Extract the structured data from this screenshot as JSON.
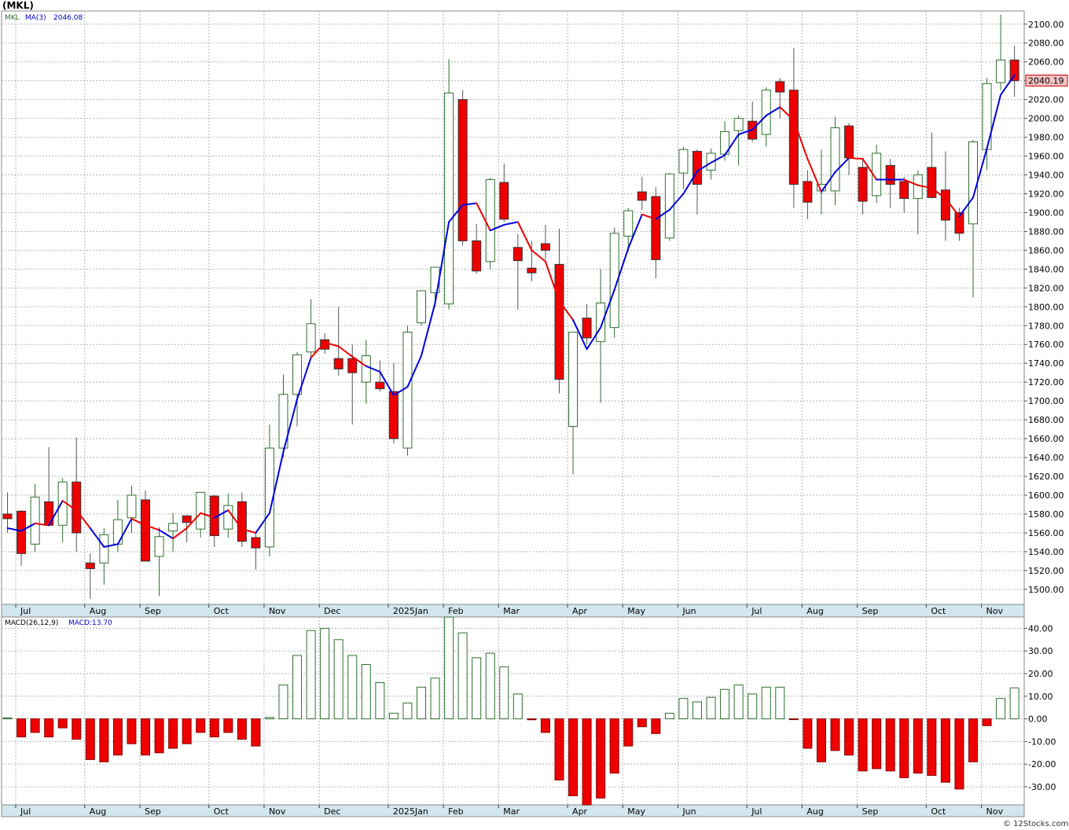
{
  "header": {
    "symbol": "(MKL)"
  },
  "chart_data": {
    "type": "candlestick",
    "symbol_label": "MKL",
    "ma_label": "MA(3)",
    "ma_value": "2046.08",
    "last_price": "2040.19",
    "price_axis": {
      "range": [
        1484,
        2114
      ],
      "ticks": [
        1500,
        1520,
        1540,
        1560,
        1580,
        1600,
        1620,
        1640,
        1660,
        1680,
        1700,
        1720,
        1740,
        1760,
        1780,
        1800,
        1820,
        1840,
        1860,
        1880,
        1900,
        1920,
        1940,
        1960,
        1980,
        2000,
        2020,
        2040,
        2060,
        2080,
        2100
      ],
      "tick_labels": [
        "1500.00",
        "1520.00",
        "1540.00",
        "1560.00",
        "1580.00",
        "1600.00",
        "1620.00",
        "1640.00",
        "1660.00",
        "1680.00",
        "1700.00",
        "1720.00",
        "1740.00",
        "1760.00",
        "1780.00",
        "1800.00",
        "1820.00",
        "1840.00",
        "1860.00",
        "1880.00",
        "1900.00",
        "1920.00",
        "1940.00",
        "1960.00",
        "1980.00",
        "2000.00",
        "2020.00",
        "2040.00",
        "2060.00",
        "2080.00",
        "2100.00"
      ]
    },
    "months": [
      {
        "label": "Jul",
        "index": 1
      },
      {
        "label": "Aug",
        "index": 6
      },
      {
        "label": "Sep",
        "index": 10
      },
      {
        "label": "Oct",
        "index": 15
      },
      {
        "label": "Nov",
        "index": 19
      },
      {
        "label": "Dec",
        "index": 23
      },
      {
        "label": "2025Jan",
        "index": 28
      },
      {
        "label": "Feb",
        "index": 32
      },
      {
        "label": "Mar",
        "index": 36
      },
      {
        "label": "Apr",
        "index": 41
      },
      {
        "label": "May",
        "index": 45
      },
      {
        "label": "Jun",
        "index": 49
      },
      {
        "label": "Jul",
        "index": 54
      },
      {
        "label": "Aug",
        "index": 58
      },
      {
        "label": "Sep",
        "index": 62
      },
      {
        "label": "Oct",
        "index": 67
      },
      {
        "label": "Nov",
        "index": 71
      }
    ],
    "candles": [
      {
        "o": 1580,
        "h": 1603,
        "l": 1560,
        "c": 1575
      },
      {
        "o": 1583,
        "h": 1584,
        "l": 1525,
        "c": 1538
      },
      {
        "o": 1548,
        "h": 1612,
        "l": 1540,
        "c": 1598
      },
      {
        "o": 1593,
        "h": 1651,
        "l": 1573,
        "c": 1568
      },
      {
        "o": 1568,
        "h": 1618,
        "l": 1550,
        "c": 1614
      },
      {
        "o": 1614,
        "h": 1661,
        "l": 1540,
        "c": 1560
      },
      {
        "o": 1528,
        "h": 1538,
        "l": 1490,
        "c": 1522
      },
      {
        "o": 1528,
        "h": 1565,
        "l": 1505,
        "c": 1558
      },
      {
        "o": 1548,
        "h": 1595,
        "l": 1540,
        "c": 1574
      },
      {
        "o": 1576,
        "h": 1610,
        "l": 1560,
        "c": 1600
      },
      {
        "o": 1595,
        "h": 1605,
        "l": 1530,
        "c": 1530
      },
      {
        "o": 1535,
        "h": 1566,
        "l": 1493,
        "c": 1556
      },
      {
        "o": 1562,
        "h": 1581,
        "l": 1540,
        "c": 1570
      },
      {
        "o": 1578,
        "h": 1579,
        "l": 1550,
        "c": 1571
      },
      {
        "o": 1564,
        "h": 1603,
        "l": 1555,
        "c": 1603
      },
      {
        "o": 1599,
        "h": 1600,
        "l": 1545,
        "c": 1557
      },
      {
        "o": 1564,
        "h": 1602,
        "l": 1555,
        "c": 1589
      },
      {
        "o": 1593,
        "h": 1603,
        "l": 1545,
        "c": 1551
      },
      {
        "o": 1555,
        "h": 1560,
        "l": 1521,
        "c": 1544
      },
      {
        "o": 1545,
        "h": 1675,
        "l": 1535,
        "c": 1650
      },
      {
        "o": 1650,
        "h": 1728,
        "l": 1640,
        "c": 1707
      },
      {
        "o": 1707,
        "h": 1752,
        "l": 1673,
        "c": 1749
      },
      {
        "o": 1752,
        "h": 1808,
        "l": 1745,
        "c": 1782
      },
      {
        "o": 1765,
        "h": 1772,
        "l": 1750,
        "c": 1755
      },
      {
        "o": 1745,
        "h": 1800,
        "l": 1727,
        "c": 1734
      },
      {
        "o": 1745,
        "h": 1760,
        "l": 1675,
        "c": 1730
      },
      {
        "o": 1720,
        "h": 1765,
        "l": 1697,
        "c": 1748
      },
      {
        "o": 1720,
        "h": 1743,
        "l": 1710,
        "c": 1713
      },
      {
        "o": 1710,
        "h": 1740,
        "l": 1655,
        "c": 1660
      },
      {
        "o": 1650,
        "h": 1780,
        "l": 1642,
        "c": 1773
      },
      {
        "o": 1783,
        "h": 1815,
        "l": 1780,
        "c": 1817
      },
      {
        "o": 1815,
        "h": 1842,
        "l": 1800,
        "c": 1842
      },
      {
        "o": 1803,
        "h": 2063,
        "l": 1797,
        "c": 2027
      },
      {
        "o": 2020,
        "h": 2030,
        "l": 1865,
        "c": 1870
      },
      {
        "o": 1870,
        "h": 1888,
        "l": 1835,
        "c": 1838
      },
      {
        "o": 1848,
        "h": 1937,
        "l": 1840,
        "c": 1935
      },
      {
        "o": 1932,
        "h": 1952,
        "l": 1890,
        "c": 1893
      },
      {
        "o": 1863,
        "h": 1877,
        "l": 1797,
        "c": 1849
      },
      {
        "o": 1841,
        "h": 1870,
        "l": 1827,
        "c": 1836
      },
      {
        "o": 1867,
        "h": 1887,
        "l": 1850,
        "c": 1860
      },
      {
        "o": 1845,
        "h": 1883,
        "l": 1708,
        "c": 1723
      },
      {
        "o": 1673,
        "h": 1773,
        "l": 1622,
        "c": 1773
      },
      {
        "o": 1788,
        "h": 1803,
        "l": 1760,
        "c": 1767
      },
      {
        "o": 1763,
        "h": 1840,
        "l": 1698,
        "c": 1804
      },
      {
        "o": 1778,
        "h": 1884,
        "l": 1767,
        "c": 1878
      },
      {
        "o": 1875,
        "h": 1905,
        "l": 1858,
        "c": 1902
      },
      {
        "o": 1922,
        "h": 1938,
        "l": 1903,
        "c": 1913
      },
      {
        "o": 1917,
        "h": 1927,
        "l": 1830,
        "c": 1850
      },
      {
        "o": 1873,
        "h": 1942,
        "l": 1870,
        "c": 1941
      },
      {
        "o": 1942,
        "h": 1970,
        "l": 1925,
        "c": 1967
      },
      {
        "o": 1965,
        "h": 1967,
        "l": 1898,
        "c": 1930
      },
      {
        "o": 1945,
        "h": 1968,
        "l": 1935,
        "c": 1963
      },
      {
        "o": 1962,
        "h": 1997,
        "l": 1955,
        "c": 1986
      },
      {
        "o": 1987,
        "h": 2003,
        "l": 1950,
        "c": 2000
      },
      {
        "o": 1997,
        "h": 2018,
        "l": 1975,
        "c": 1978
      },
      {
        "o": 1983,
        "h": 2033,
        "l": 1970,
        "c": 2030
      },
      {
        "o": 2039,
        "h": 2043,
        "l": 2000,
        "c": 2028
      },
      {
        "o": 2030,
        "h": 2075,
        "l": 1905,
        "c": 1930
      },
      {
        "o": 1933,
        "h": 1945,
        "l": 1893,
        "c": 1911
      },
      {
        "o": 1923,
        "h": 1967,
        "l": 1898,
        "c": 1930
      },
      {
        "o": 1923,
        "h": 2002,
        "l": 1908,
        "c": 1990
      },
      {
        "o": 1992,
        "h": 1995,
        "l": 1940,
        "c": 1958
      },
      {
        "o": 1948,
        "h": 1958,
        "l": 1898,
        "c": 1912
      },
      {
        "o": 1918,
        "h": 1972,
        "l": 1910,
        "c": 1963
      },
      {
        "o": 1950,
        "h": 1957,
        "l": 1905,
        "c": 1930
      },
      {
        "o": 1933,
        "h": 1938,
        "l": 1900,
        "c": 1915
      },
      {
        "o": 1915,
        "h": 1945,
        "l": 1877,
        "c": 1940
      },
      {
        "o": 1948,
        "h": 1985,
        "l": 1915,
        "c": 1916
      },
      {
        "o": 1924,
        "h": 1965,
        "l": 1870,
        "c": 1892
      },
      {
        "o": 1900,
        "h": 1905,
        "l": 1870,
        "c": 1878
      },
      {
        "o": 1888,
        "h": 1977,
        "l": 1810,
        "c": 1975
      },
      {
        "o": 1967,
        "h": 2043,
        "l": 1945,
        "c": 2037
      },
      {
        "o": 2038,
        "h": 2110,
        "l": 2030,
        "c": 2062
      },
      {
        "o": 2062,
        "h": 2077,
        "l": 2023,
        "c": 2040
      }
    ],
    "ma": [
      1565,
      1562,
      1570,
      1568,
      1594,
      1584,
      1565,
      1545,
      1548,
      1575,
      1568,
      1563,
      1554,
      1565,
      1581,
      1576,
      1584,
      1564,
      1560,
      1581,
      1646,
      1702,
      1746,
      1762,
      1758,
      1747,
      1737,
      1731,
      1706,
      1715,
      1748,
      1804,
      1890,
      1908,
      1910,
      1881,
      1887,
      1890,
      1860,
      1848,
      1806,
      1786,
      1755,
      1778,
      1818,
      1862,
      1898,
      1893,
      1903,
      1920,
      1944,
      1953,
      1961,
      1983,
      1988,
      2003,
      2012,
      1998,
      1957,
      1922,
      1943,
      1958,
      1957,
      1935,
      1935,
      1935,
      1929,
      1926,
      1915,
      1896,
      1916,
      1968,
      2025,
      2046
    ],
    "ma_colors": [
      "red",
      "blue",
      "blue",
      "red",
      "blue",
      "red",
      "red",
      "blue",
      "blue",
      "blue",
      "red",
      "red",
      "blue",
      "red",
      "red",
      "red",
      "blue",
      "red",
      "red",
      "blue",
      "blue",
      "blue",
      "blue",
      "red",
      "red",
      "red",
      "red",
      "blue",
      "blue",
      "blue",
      "blue",
      "blue",
      "blue",
      "blue",
      "blue",
      "red",
      "blue",
      "blue",
      "red",
      "red",
      "red",
      "red",
      "blue",
      "blue",
      "blue",
      "blue",
      "blue",
      "red",
      "blue",
      "blue",
      "blue",
      "blue",
      "blue",
      "blue",
      "blue",
      "blue",
      "blue",
      "red",
      "red",
      "red",
      "blue",
      "blue",
      "red",
      "red",
      "blue",
      "blue",
      "red",
      "red",
      "red",
      "red",
      "blue",
      "blue",
      "blue",
      "blue"
    ],
    "macd_label": "MACD(26,12,9)",
    "macd_value_label": "MACD:13.70",
    "macd_axis": {
      "range": [
        -38,
        45
      ],
      "ticks": [
        -30,
        -20,
        -10,
        0,
        10,
        20,
        30,
        40
      ],
      "tick_labels": [
        "-30.00",
        "-20.00",
        "-10.00",
        "0.00",
        "10.00",
        "20.00",
        "30.00",
        "40.00"
      ]
    },
    "macd": [
      0.4,
      -8,
      -6,
      -8,
      -4,
      -9,
      -18,
      -19,
      -16,
      -11,
      -16,
      -15,
      -13,
      -11,
      -6,
      -8,
      -6,
      -9,
      -12,
      0.6,
      15,
      28,
      39,
      40,
      35,
      28,
      24,
      16,
      2.5,
      7,
      14,
      18,
      45,
      38,
      27,
      29,
      23,
      11,
      -0.4,
      -6,
      -27,
      -34,
      -38,
      -35,
      -24,
      -12,
      -3.5,
      -6.5,
      2.5,
      9,
      7.5,
      9.5,
      13,
      15,
      11,
      14,
      14,
      -0.2,
      -13,
      -19,
      -14,
      -16,
      -23,
      -22,
      -23,
      -26,
      -24,
      -25,
      -28,
      -31,
      -19,
      -3,
      9,
      13.7
    ]
  }
}
